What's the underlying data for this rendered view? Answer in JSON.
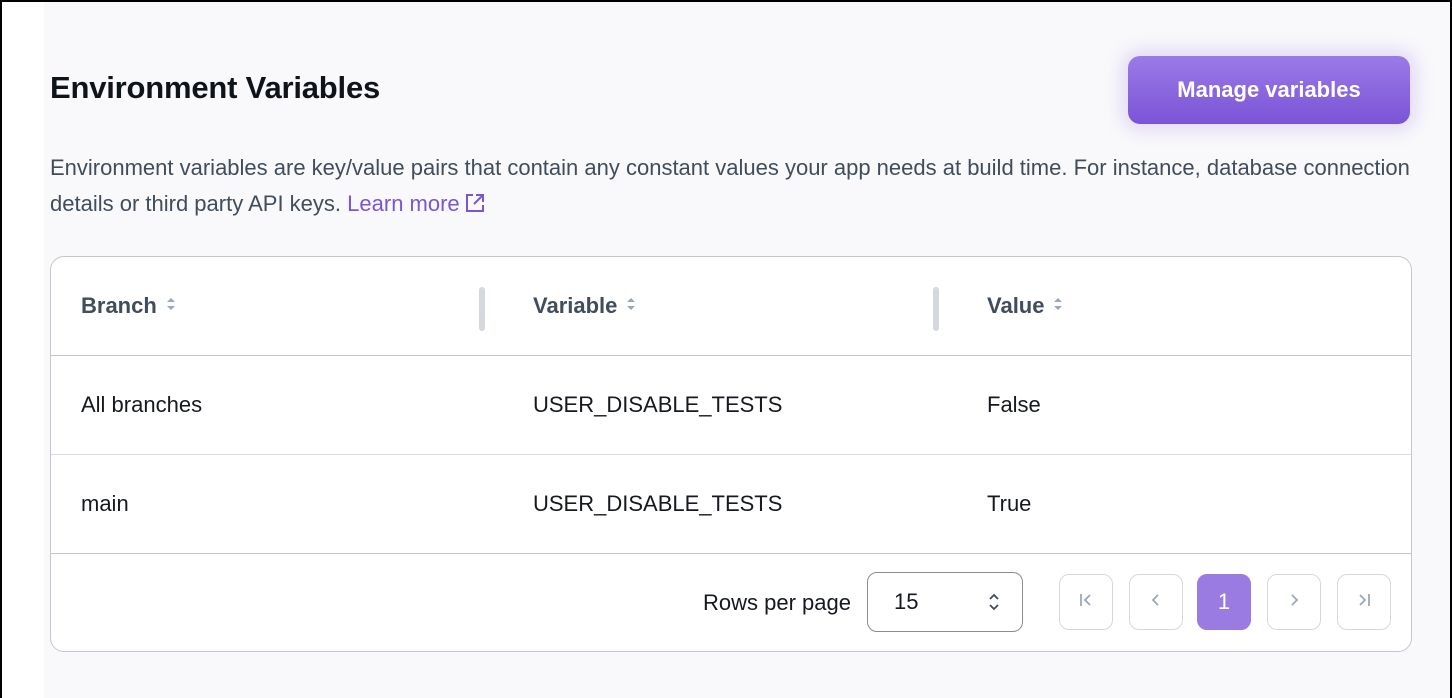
{
  "section": {
    "title": "Environment Variables",
    "manage_label": "Manage variables",
    "description": "Environment variables are key/value pairs that contain any constant values your app needs at build time. For instance, database connection details or third party API keys.",
    "learn_more_label": "Learn more"
  },
  "table": {
    "columns": [
      "Branch",
      "Variable",
      "Value"
    ],
    "rows": [
      {
        "branch": "All branches",
        "variable": "USER_DISABLE_TESTS",
        "value": "False"
      },
      {
        "branch": "main",
        "variable": "USER_DISABLE_TESTS",
        "value": "True"
      }
    ]
  },
  "pagination": {
    "rows_per_page_label": "Rows per page",
    "rows_per_page_value": "15",
    "current_page": "1"
  },
  "colors": {
    "accent": "#7b54d6",
    "link": "#7a56d6",
    "current_page_bg": "#9a7be2"
  },
  "icons": {
    "sort": "sort-caret-icon",
    "external_link": "external-link-icon",
    "select_caret": "up-down-caret-icon",
    "first_page": "first-page-icon",
    "prev_page": "chevron-left-icon",
    "next_page": "chevron-right-icon",
    "last_page": "last-page-icon"
  }
}
